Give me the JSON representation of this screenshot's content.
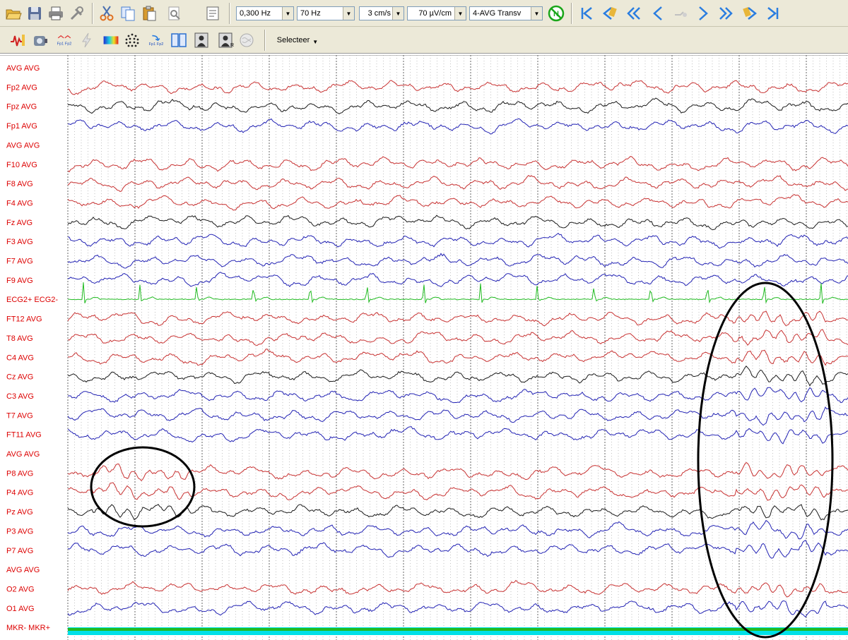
{
  "toolbar1": {
    "buttons": [
      {
        "name": "open-folder-icon",
        "color": "#e8b63a"
      },
      {
        "name": "save-icon",
        "color": "#5b6f9a"
      },
      {
        "name": "print-icon",
        "color": "#7a7a7a"
      },
      {
        "name": "settings-tools-icon",
        "color": "#8a8a8a"
      },
      {
        "name": "cut-icon",
        "color": "#e07020"
      },
      {
        "name": "copy-icon",
        "color": "#4a7fd0"
      },
      {
        "name": "paste-icon",
        "color": "#d89b30"
      },
      {
        "name": "print-preview-icon",
        "color": "#a0a0a0"
      },
      {
        "name": "page-setup-icon",
        "color": "#666666"
      }
    ],
    "combos": [
      {
        "value": "0,300 Hz"
      },
      {
        "value": "70 Hz"
      },
      {
        "value": "3 cm/s"
      },
      {
        "value": "70 µV/cm"
      },
      {
        "value": "4-AVG Transv"
      }
    ],
    "nav_buttons": [
      "go-first-icon",
      "jump-back-icon",
      "fast-back-icon",
      "back-icon",
      "blank-icon",
      "forward-icon",
      "fast-forward-icon",
      "jump-forward-icon",
      "go-last-icon"
    ]
  },
  "toolbar2": {
    "buttons": [
      "waveform-icon",
      "camera-icon",
      "montage-fp1-fp2-icon",
      "disabled-flash-icon",
      "spectrum-map-icon",
      "electrode-grid-icon",
      "reference-fp1-fp2-icon",
      "split-view-icon",
      "video-person-icon",
      "video-person-r-icon",
      "brain-map-icon"
    ],
    "fp_label": "Fp1 Fp2",
    "select_label": "Selecteer"
  },
  "colors": {
    "red": "#c83232",
    "black": "#1a1a1a",
    "blue": "#2323b4",
    "green": "#22bb22",
    "cyan": "#00e0e8",
    "label": "#dd0000"
  },
  "channels": [
    {
      "label": "AVG AVG",
      "color": "none"
    },
    {
      "label": "Fp2 AVG",
      "color": "red"
    },
    {
      "label": "Fpz AVG",
      "color": "black"
    },
    {
      "label": "Fp1 AVG",
      "color": "blue"
    },
    {
      "label": "AVG AVG",
      "color": "none"
    },
    {
      "label": "F10 AVG",
      "color": "red"
    },
    {
      "label": "F8 AVG",
      "color": "red"
    },
    {
      "label": "F4 AVG",
      "color": "red"
    },
    {
      "label": "Fz AVG",
      "color": "black"
    },
    {
      "label": "F3 AVG",
      "color": "blue"
    },
    {
      "label": "F7 AVG",
      "color": "blue"
    },
    {
      "label": "F9 AVG",
      "color": "blue"
    },
    {
      "label": "ECG2+ ECG2-",
      "color": "green"
    },
    {
      "label": "FT12 AVG",
      "color": "red"
    },
    {
      "label": "T8 AVG",
      "color": "red"
    },
    {
      "label": "C4 AVG",
      "color": "red"
    },
    {
      "label": "Cz AVG",
      "color": "black"
    },
    {
      "label": "C3 AVG",
      "color": "blue"
    },
    {
      "label": "T7 AVG",
      "color": "blue"
    },
    {
      "label": "FT11 AVG",
      "color": "blue"
    },
    {
      "label": "AVG AVG",
      "color": "none"
    },
    {
      "label": "P8 AVG",
      "color": "red"
    },
    {
      "label": "P4 AVG",
      "color": "red"
    },
    {
      "label": "Pz AVG",
      "color": "black"
    },
    {
      "label": "P3 AVG",
      "color": "blue"
    },
    {
      "label": "P7 AVG",
      "color": "blue"
    },
    {
      "label": "AVG AVG",
      "color": "none"
    },
    {
      "label": "O2 AVG",
      "color": "red"
    },
    {
      "label": "O1 AVG",
      "color": "blue"
    },
    {
      "label": "MKR- MKR+",
      "color": "marker"
    }
  ],
  "annotations": [
    {
      "name": "annotation-circle-left",
      "shape": "ellipse"
    },
    {
      "name": "annotation-circle-right",
      "shape": "ellipse"
    }
  ]
}
